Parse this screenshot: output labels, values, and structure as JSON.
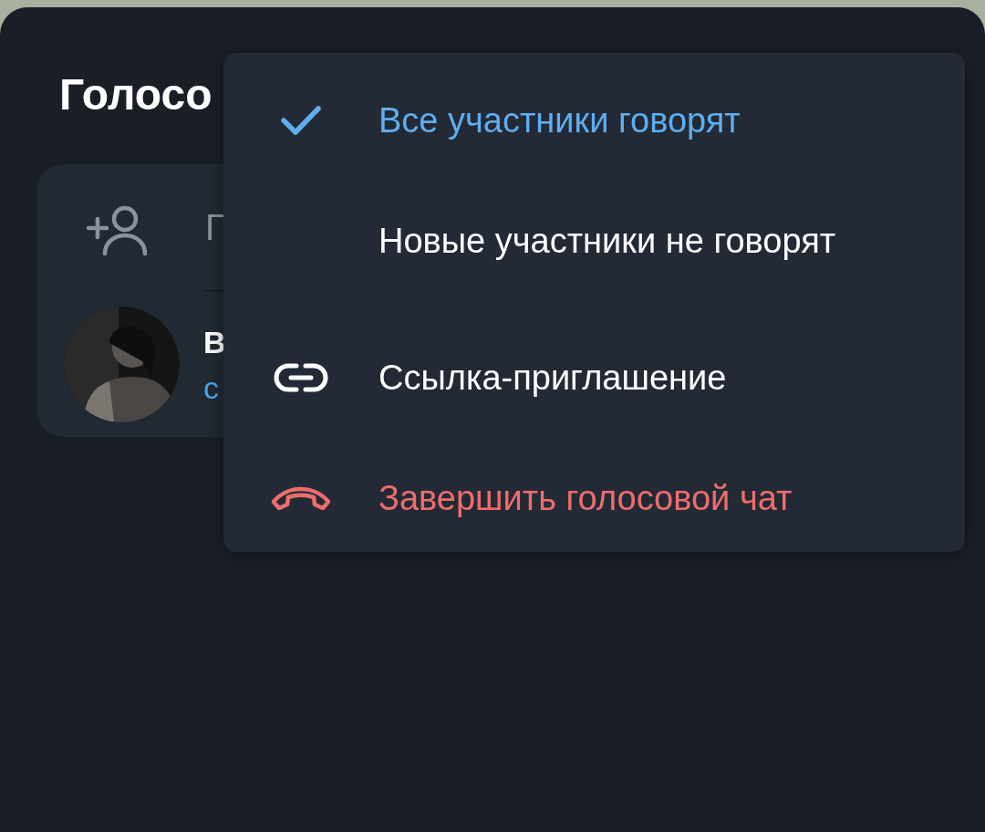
{
  "sheet": {
    "title": "Голосо",
    "invite": {
      "label": "Г"
    },
    "participants": [
      {
        "name": "В",
        "status": "с"
      }
    ]
  },
  "menu": {
    "items": [
      {
        "kind": "option",
        "label": "Все участники говорят",
        "selected": true
      },
      {
        "kind": "option",
        "label": "Новые участники не говорят",
        "selected": false
      },
      {
        "kind": "link",
        "label": "Ссылка-приглашение"
      },
      {
        "kind": "end-call",
        "label": "Завершить голосовой чат"
      }
    ]
  }
}
